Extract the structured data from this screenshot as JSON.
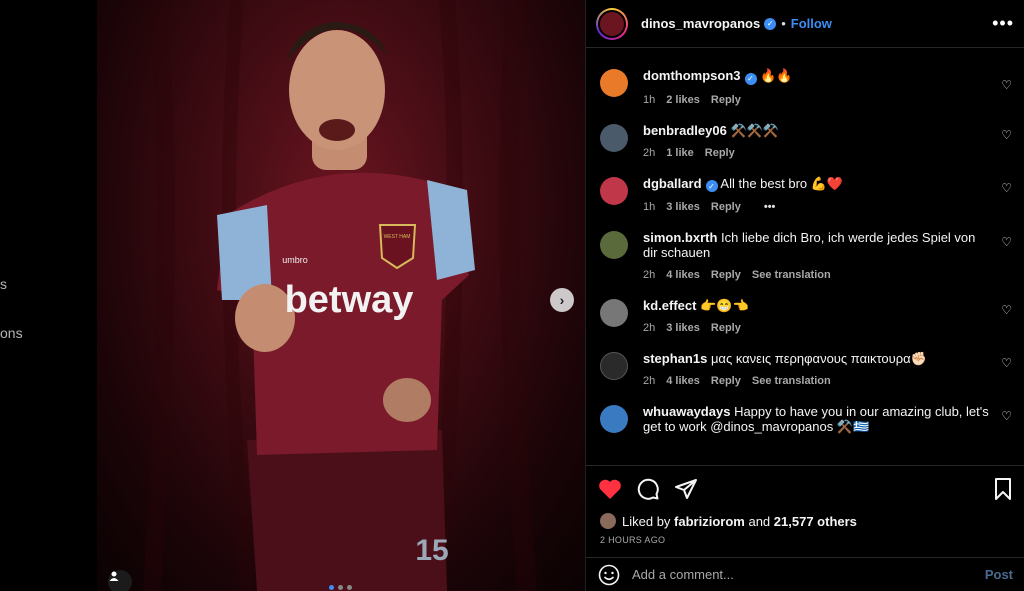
{
  "sidebar": {
    "fragments": [
      "s",
      "ons"
    ]
  },
  "post": {
    "author": "dinos_mavropanos",
    "separator": "•",
    "follow_label": "Follow",
    "more_label": "•••",
    "carousel": {
      "current": 1,
      "total": 3
    },
    "next_label": "›"
  },
  "comments": [
    {
      "user": "domthompson3",
      "verified": true,
      "text": "🔥🔥",
      "time": "1h",
      "likes": "2 likes",
      "reply": "Reply",
      "avatar_color": "#e87a2a"
    },
    {
      "user": "benbradley06",
      "verified": false,
      "text": "⚒️⚒️⚒️",
      "time": "2h",
      "likes": "1 like",
      "reply": "Reply",
      "avatar_color": "#4a5a6a"
    },
    {
      "user": "dgballard",
      "verified": true,
      "text": "All the best bro 💪❤️",
      "time": "1h",
      "likes": "3 likes",
      "reply": "Reply",
      "more": "•••",
      "avatar_color": "#c0374a"
    },
    {
      "user": "simon.bxrth",
      "verified": false,
      "text": "Ich liebe dich Bro, ich werde jedes Spiel von dir schauen",
      "time": "2h",
      "likes": "4 likes",
      "reply": "Reply",
      "translate": "See translation",
      "avatar_color": "#5a6a3a"
    },
    {
      "user": "kd.effect",
      "verified": false,
      "text": "👉😁👈",
      "time": "2h",
      "likes": "3 likes",
      "reply": "Reply",
      "avatar_color": "#777777"
    },
    {
      "user": "stephan1s",
      "verified": false,
      "text": "μας κανεις περηφανους παικτουρα✊🏻",
      "time": "2h",
      "likes": "4 likes",
      "reply": "Reply",
      "translate": "See translation",
      "avatar_color": "#2a2a2a"
    },
    {
      "user": "whuawaydays",
      "verified": false,
      "text": "Happy to have you in our amazing club, let's get to work @dinos_mavropanos ⚒️🇬🇷",
      "avatar_color": "#3a7ac0"
    }
  ],
  "likes": {
    "prefix": "Liked by",
    "by": "fabriziorom",
    "joiner": "and",
    "others": "21,577 others"
  },
  "timestamp": "2 HOURS AGO",
  "add_comment": {
    "placeholder": "Add a comment...",
    "post_label": "Post"
  },
  "colors": {
    "accent": "#3c8ef5",
    "like": "#ff3040",
    "jersey": "#7a1a2a"
  },
  "icons": [
    "emoji-icon",
    "heart-icon",
    "comment-icon",
    "share-icon",
    "bookmark-icon",
    "verified-icon",
    "user-tag-icon",
    "chevron-right-icon"
  ]
}
